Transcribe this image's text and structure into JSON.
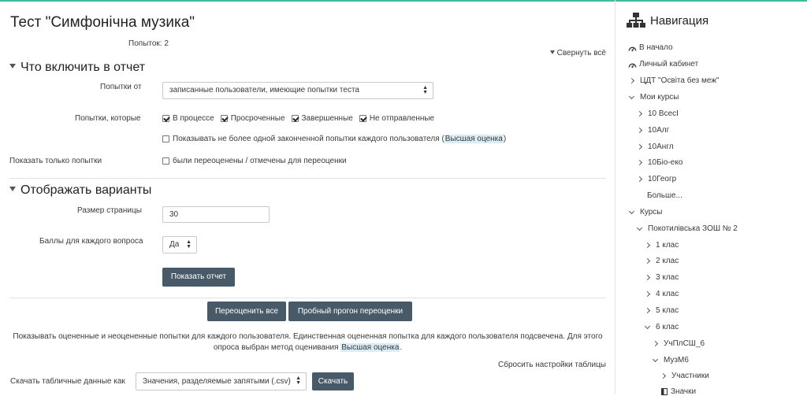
{
  "quiz": {
    "title": "Тест \"Симфонічна музика\"",
    "attempts_count": "Попыток: 2",
    "collapse_all": "Свернуть всё"
  },
  "include_section": {
    "title": "Что включить в отчет",
    "attempts_from_label": "Попытки от",
    "attempts_from_value": "записанные пользователи, имеющие попытки теста",
    "attempts_which_label": "Попытки, которые",
    "states": [
      {
        "label": "В процессе",
        "checked": true
      },
      {
        "label": "Просроченные",
        "checked": true
      },
      {
        "label": "Завершенные",
        "checked": true
      },
      {
        "label": "Не отправленные",
        "checked": true
      }
    ],
    "one_attempt_prefix": "Показывать не более одной законченной попытки каждого пользователя (",
    "one_attempt_method": "Высшая оценка",
    "one_attempt_suffix": ")",
    "show_only_label": "Показать только попытки",
    "regraded_label": "были переоценены / отмечены для переоценки"
  },
  "display_section": {
    "title": "Отображать варианты",
    "page_size_label": "Размер страницы",
    "page_size_value": "30",
    "marks_label": "Баллы для каждого вопроса",
    "marks_value": "Да",
    "show_report_button": "Показать отчет"
  },
  "actions": {
    "regrade_all": "Переоценить все",
    "dry_run": "Пробный прогон переоценки"
  },
  "info": {
    "text_1": "Показывать оцененные и неоцененные попытки для каждого пользователя. Единственная оцененная попытка для каждого пользователя подсвечена. Для этого опроса выбран метод оценивания ",
    "method": "Высшая оценка",
    "text_2": "."
  },
  "table": {
    "reset": "Сбросить настройки таблицы",
    "download_label": "Скачать табличные данные как",
    "download_format": "Значения, разделяемые запятыми (.csv)",
    "download_button": "Скачать"
  },
  "nav": {
    "title": "Навигация",
    "items": [
      {
        "label": "В начало"
      },
      {
        "label": "Личный кабинет"
      },
      {
        "label": "ЦДТ \"Освіта без меж\""
      },
      {
        "label": "Мои курсы"
      },
      {
        "label": "10 ВсесІ"
      },
      {
        "label": "10Алг"
      },
      {
        "label": "10Англ"
      },
      {
        "label": "10Біо-еко"
      },
      {
        "label": "10Геогр"
      },
      {
        "label": "Больше..."
      },
      {
        "label": "Курсы"
      },
      {
        "label": "Покотилівська ЗОШ № 2"
      },
      {
        "label": "1 клас"
      },
      {
        "label": "2 клас"
      },
      {
        "label": "3 клас"
      },
      {
        "label": "4 клас"
      },
      {
        "label": "5 клас"
      },
      {
        "label": "6 клас"
      },
      {
        "label": "УчПлСШ_6"
      },
      {
        "label": "МузМ6"
      },
      {
        "label": "Участники"
      },
      {
        "label": "Значки"
      }
    ]
  },
  "colors": {
    "accent": "#3dbb9a",
    "button": "#485a68",
    "highlight": "#dcecf5"
  }
}
